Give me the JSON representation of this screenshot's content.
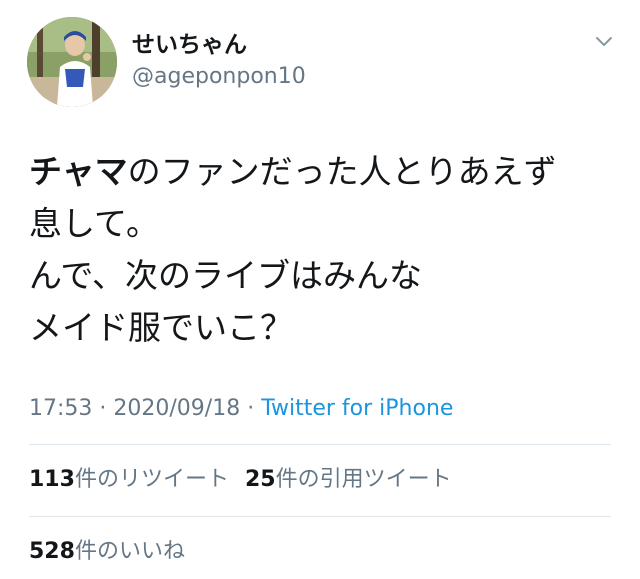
{
  "author": {
    "display_name": "せいちゃん",
    "handle": "@ageponpon10",
    "avatar_icon": "profile-photo"
  },
  "tweet": {
    "lines": [
      {
        "bold": "チャマ",
        "rest": "のファンだった人とりあえず"
      },
      {
        "bold": "",
        "rest": "息して。"
      },
      {
        "bold": "",
        "rest": "んで、次のライブはみんな"
      },
      {
        "bold": "",
        "rest": "メイド服でいこ？"
      }
    ]
  },
  "meta": {
    "time": "17:53",
    "sep1": " · ",
    "date": "2020/09/18",
    "sep2": " · ",
    "source": "Twitter for iPhone"
  },
  "stats": {
    "retweets_count": "113",
    "retweets_label": "件のリツイート",
    "quotes_count": "25",
    "quotes_label": "件の引用ツイート",
    "likes_count": "528",
    "likes_label": "件のいいね"
  },
  "colors": {
    "text": "#14171a",
    "secondary": "#657786",
    "link": "#1b95e0",
    "divider": "#e1e8ed"
  },
  "icons": {
    "menu": "chevron-down-icon"
  }
}
